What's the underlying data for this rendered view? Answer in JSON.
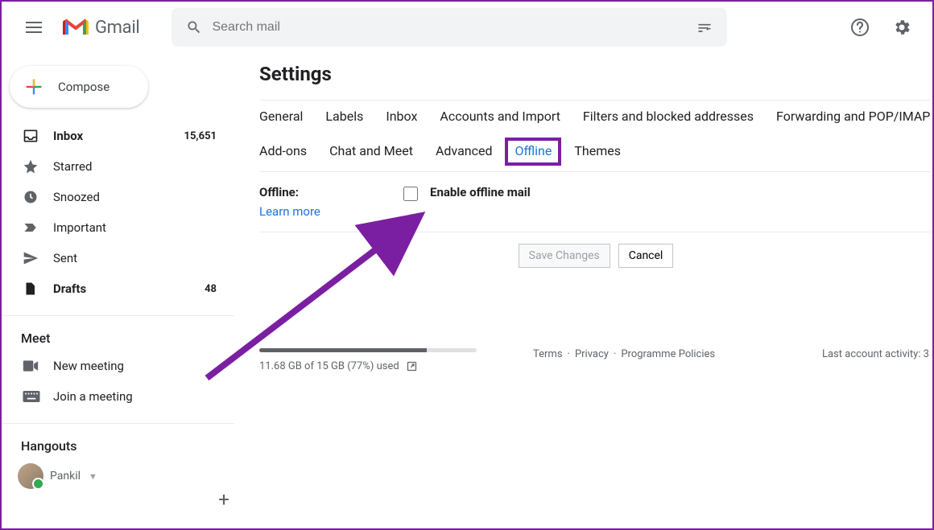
{
  "header": {
    "product_name": "Gmail",
    "search_placeholder": "Search mail"
  },
  "sidebar": {
    "compose_label": "Compose",
    "items": [
      {
        "icon": "inbox-icon",
        "label": "Inbox",
        "count": "15,651",
        "bold": true
      },
      {
        "icon": "star-icon",
        "label": "Starred",
        "count": ""
      },
      {
        "icon": "clock-icon",
        "label": "Snoozed",
        "count": ""
      },
      {
        "icon": "important-icon",
        "label": "Important",
        "count": ""
      },
      {
        "icon": "sent-icon",
        "label": "Sent",
        "count": ""
      },
      {
        "icon": "drafts-icon",
        "label": "Drafts",
        "count": "48",
        "bold": true
      }
    ],
    "meet_label": "Meet",
    "meet_items": [
      {
        "icon": "camera-icon",
        "label": "New meeting"
      },
      {
        "icon": "keyboard-icon",
        "label": "Join a meeting"
      }
    ],
    "hangouts_label": "Hangouts",
    "hangouts_user": "Pankil"
  },
  "settings": {
    "title": "Settings",
    "tabs": [
      "General",
      "Labels",
      "Inbox",
      "Accounts and Import",
      "Filters and blocked addresses",
      "Forwarding and POP/IMAP",
      "Add-ons",
      "Chat and Meet",
      "Advanced",
      "Offline",
      "Themes"
    ],
    "active_tab_index": 9,
    "offline_section": {
      "label": "Offline:",
      "learn_more": "Learn more",
      "checkbox_label": "Enable offline mail",
      "checked": false
    },
    "save_label": "Save Changes",
    "cancel_label": "Cancel"
  },
  "footer": {
    "storage_text": "11.68 GB of 15 GB (77%) used",
    "storage_percent": 77,
    "links": [
      "Terms",
      "Privacy",
      "Programme Policies"
    ],
    "activity": "Last account activity: 3"
  }
}
